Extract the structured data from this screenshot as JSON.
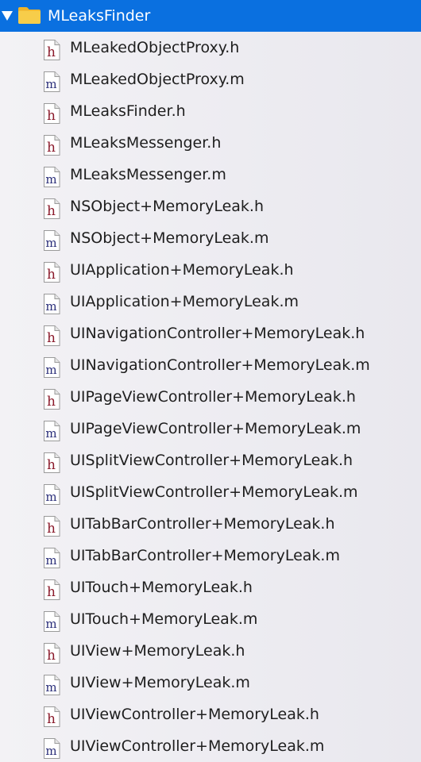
{
  "folder": {
    "name": "MLeaksFinder",
    "icon": "folder-icon",
    "expanded": true,
    "accent_color": "#0a70e0",
    "folder_color": "#f6c33a"
  },
  "header_letter_color": "#8b1a2b",
  "impl_letter_color": "#2b2f7a",
  "files": [
    {
      "name": "MLeakedObjectProxy.h",
      "type": "h"
    },
    {
      "name": "MLeakedObjectProxy.m",
      "type": "m"
    },
    {
      "name": "MLeaksFinder.h",
      "type": "h"
    },
    {
      "name": "MLeaksMessenger.h",
      "type": "h"
    },
    {
      "name": "MLeaksMessenger.m",
      "type": "m"
    },
    {
      "name": "NSObject+MemoryLeak.h",
      "type": "h"
    },
    {
      "name": "NSObject+MemoryLeak.m",
      "type": "m"
    },
    {
      "name": "UIApplication+MemoryLeak.h",
      "type": "h"
    },
    {
      "name": "UIApplication+MemoryLeak.m",
      "type": "m"
    },
    {
      "name": "UINavigationController+MemoryLeak.h",
      "type": "h"
    },
    {
      "name": "UINavigationController+MemoryLeak.m",
      "type": "m"
    },
    {
      "name": "UIPageViewController+MemoryLeak.h",
      "type": "h"
    },
    {
      "name": "UIPageViewController+MemoryLeak.m",
      "type": "m"
    },
    {
      "name": "UISplitViewController+MemoryLeak.h",
      "type": "h"
    },
    {
      "name": "UISplitViewController+MemoryLeak.m",
      "type": "m"
    },
    {
      "name": "UITabBarController+MemoryLeak.h",
      "type": "h"
    },
    {
      "name": "UITabBarController+MemoryLeak.m",
      "type": "m"
    },
    {
      "name": "UITouch+MemoryLeak.h",
      "type": "h"
    },
    {
      "name": "UITouch+MemoryLeak.m",
      "type": "m"
    },
    {
      "name": "UIView+MemoryLeak.h",
      "type": "h"
    },
    {
      "name": "UIView+MemoryLeak.m",
      "type": "m"
    },
    {
      "name": "UIViewController+MemoryLeak.h",
      "type": "h"
    },
    {
      "name": "UIViewController+MemoryLeak.m",
      "type": "m"
    }
  ]
}
